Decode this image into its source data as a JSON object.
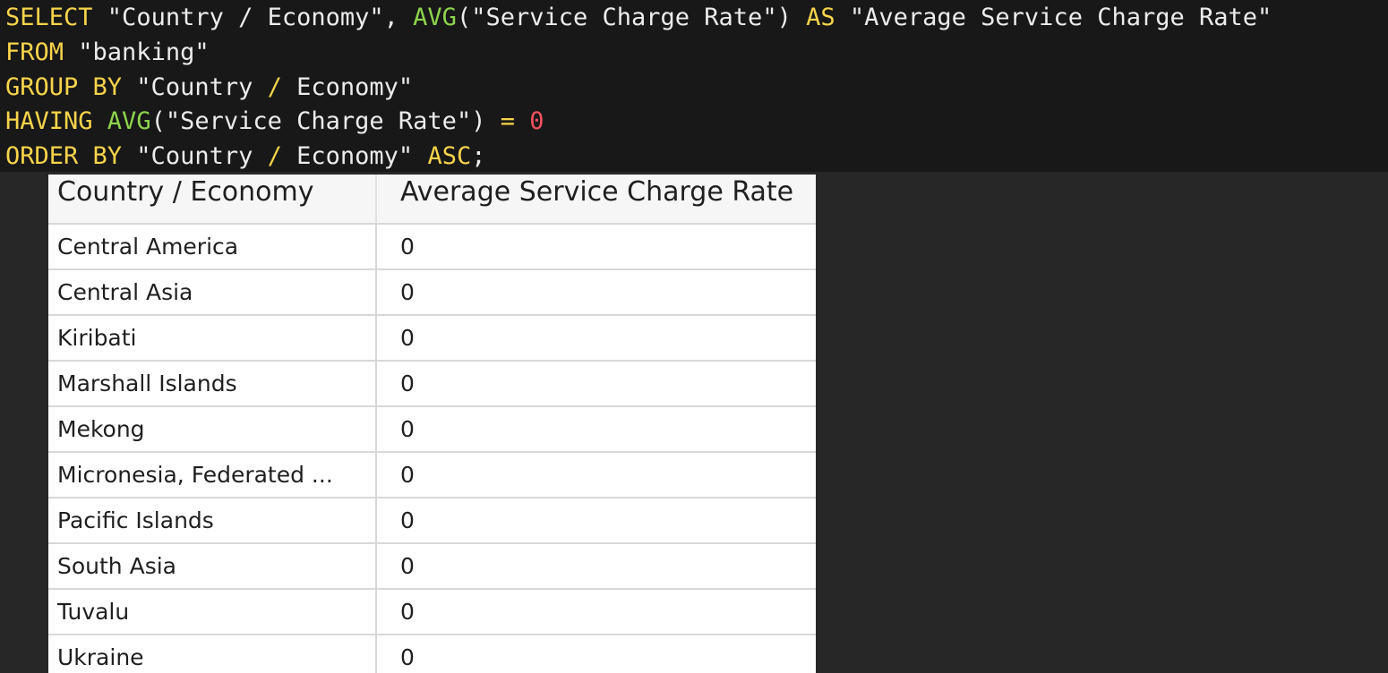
{
  "query": {
    "line1": {
      "kw_select": "SELECT",
      "col1": " \"Country / Economy\", ",
      "fn_avg": "AVG",
      "arg": "(\"Service Charge Rate\") ",
      "kw_as": "AS",
      "alias": " \"Average Service Charge Rate\""
    },
    "line2": {
      "kw_from": "FROM",
      "table": " \"banking\""
    },
    "line3": {
      "kw_group_by": "GROUP BY",
      "group_col_a": " \"Country ",
      "slash": "/",
      "group_col_b": " Economy\""
    },
    "line4": {
      "kw_having": "HAVING",
      "fn_avg": " AVG",
      "arg": "(\"Service Charge Rate\") ",
      "op_eq": "=",
      "space": " ",
      "num": "0"
    },
    "line5": {
      "kw_order_by": "ORDER BY",
      "order_col_a": " \"Country ",
      "slash": "/",
      "order_col_b": " Economy\" ",
      "kw_asc": "ASC",
      "semicolon": ";"
    }
  },
  "results": {
    "columns": [
      "Country / Economy",
      "Average Service Charge Rate"
    ],
    "rows": [
      [
        "Central America",
        "0"
      ],
      [
        "Central Asia",
        "0"
      ],
      [
        "Kiribati",
        "0"
      ],
      [
        "Marshall Islands",
        "0"
      ],
      [
        "Mekong",
        "0"
      ],
      [
        "Micronesia, Federated ...",
        "0"
      ],
      [
        "Pacific Islands",
        "0"
      ],
      [
        "South Asia",
        "0"
      ],
      [
        "Tuvalu",
        "0"
      ],
      [
        "Ukraine",
        "0"
      ]
    ]
  }
}
